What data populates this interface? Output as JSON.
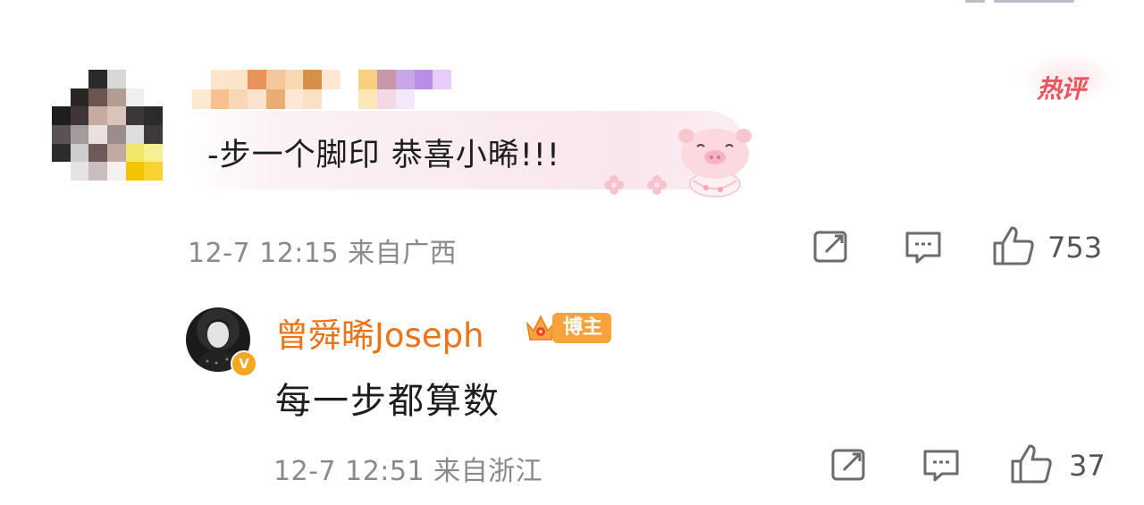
{
  "comment": {
    "text": "-步一个脚印 恭喜小晞!!!",
    "hot_label": "热评",
    "meta": "12-7 12:15  来自广西",
    "like_count": "753"
  },
  "reply": {
    "author": "曾舜晞Joseph",
    "badge_label": "博主",
    "verified_mark": "V",
    "text": "每一步都算数",
    "meta": "12-7 12:51  来自浙江",
    "like_count": "37"
  },
  "colors": {
    "accent_orange": "#eb7318",
    "hot_red": "#e8575d",
    "meta_gray": "#8a8a8a",
    "badge_orange": "#f7a23a"
  },
  "icons": {
    "share": "share-icon",
    "comment": "comment-icon",
    "like": "thumbs-up-icon"
  }
}
